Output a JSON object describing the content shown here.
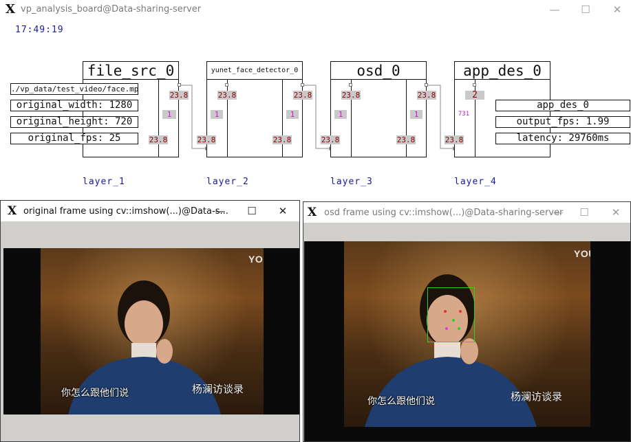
{
  "main_window": {
    "title": "vp_analysis_board@Data-sharing-server",
    "minimize": "—",
    "maximize": "☐",
    "close": "✕"
  },
  "clock": "17:49:19",
  "nodes": {
    "file_src": {
      "title": "file_src_0",
      "fields": [
        "./vp_data/test_video/face.mp4",
        "original_width: 1280",
        "original_height: 720",
        "original_fps: 25"
      ],
      "out_fps_top": "23.8",
      "out_queue": "1",
      "out_fps_bottom": "23.8"
    },
    "yunet": {
      "title": "yunet_face_detector_0",
      "in_fps": "23.8",
      "in_fps_top": "23.8",
      "in_queue": "1",
      "out_fps_top": "23.8",
      "out_queue": "1",
      "out_fps_bottom": "23.8"
    },
    "osd": {
      "title": "osd_0",
      "in_fps": "23.8",
      "in_fps_top": "23.8",
      "in_queue": "1",
      "out_fps_top": "23.8",
      "out_queue": "1",
      "out_fps_bottom": "23.8"
    },
    "app_des": {
      "title": "app_des_0",
      "in_fps": "23.8",
      "in_queue": "2",
      "in_count": "731",
      "fields": [
        "app_des_0",
        "output_fps: 1.99",
        "latency: 29760ms"
      ]
    }
  },
  "layers": [
    "layer_1",
    "layer_2",
    "layer_3",
    "layer_4"
  ],
  "original_window": {
    "title": "original frame using cv::imshow(...)@Data-s...",
    "minimize": "—",
    "maximize": "☐",
    "close": "✕",
    "logo_text": "YOUKU",
    "subtitle": "你怎么跟他们说",
    "watermark": "杨澜访谈录"
  },
  "osd_window": {
    "title": "osd frame using cv::imshow(...)@Data-sharing-server",
    "minimize": "—",
    "maximize": "☐",
    "close": "✕",
    "logo_text": "YOUKU",
    "subtitle": "你怎么跟他们说",
    "watermark": "杨澜访谈录"
  },
  "colors": {
    "clock_blue": "#1a1aa0",
    "badge_grey": "#c9c9c9",
    "badge_red": "#8b0000",
    "badge_pink": "#d40fd4",
    "face_box_green": "#2bd12b"
  },
  "icons": [
    "x-logo-icon",
    "minimize-icon",
    "maximize-icon",
    "close-icon",
    "youku-play-icon",
    "face-landmark-icon"
  ]
}
